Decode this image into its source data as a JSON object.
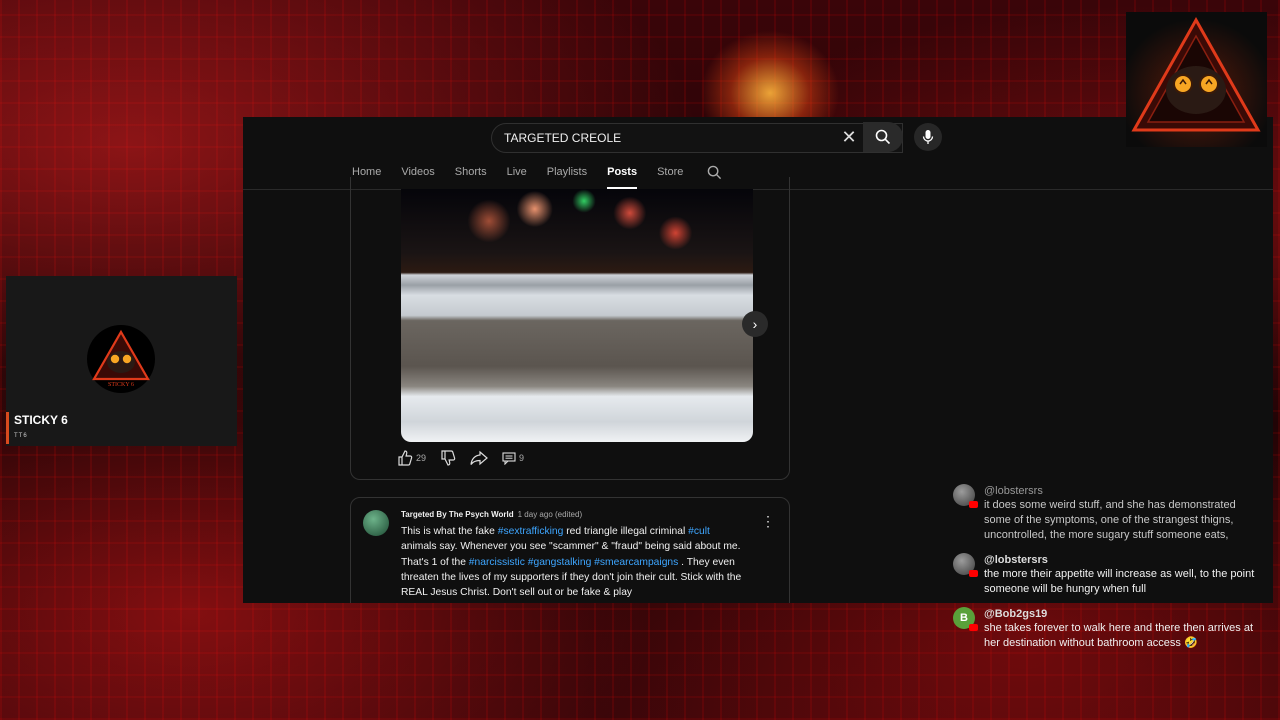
{
  "search": {
    "query": "TARGETED CREOLE"
  },
  "channel_tabs": [
    {
      "label": "Home"
    },
    {
      "label": "Videos"
    },
    {
      "label": "Shorts"
    },
    {
      "label": "Live"
    },
    {
      "label": "Playlists"
    },
    {
      "label": "Posts"
    },
    {
      "label": "Store"
    }
  ],
  "active_tab": "Posts",
  "post1": {
    "likes": "29",
    "comments": "9"
  },
  "post2": {
    "author": "Targeted By The Psych World",
    "time": "1 day ago (edited)",
    "text_parts": [
      "This is what the fake ",
      "#sextrafficking",
      " red triangle illegal criminal ",
      "#cult",
      " animals say. Whenever you see \"scammer\" & \"fraud\" being said about me. That's 1 of the ",
      "#narcissistic",
      " ",
      "#gangstalking",
      " ",
      "#smearcampaigns",
      " . They even threaten the lives of my supporters if they don't join their cult. Stick with the REAL Jesus Christ. Don't sell out or be fake & play"
    ]
  },
  "profile": {
    "name": "STICKY 6",
    "subtitle": "TT6",
    "logo_text": "STICKY 6"
  },
  "chat": [
    {
      "user": "@lobstersrs",
      "text": "it does some weird stuff, and she has demonstrated some of the symptoms, one of the strangest thigns, uncontrolled, the more sugary stuff someone eats,",
      "avatar": "image"
    },
    {
      "user": "@lobstersrs",
      "text": "the more their appetite will increase as well, to the point someone will be hungry when full",
      "avatar": "image"
    },
    {
      "user": "@Bob2gs19",
      "text": "she takes forever to walk here and there then arrives at her destination without bathroom access 🤣",
      "avatar": "B"
    }
  ],
  "colors": {
    "accent_red": "#ff0000",
    "hashtag_blue": "#3ea6ff",
    "profile_bar": "#d84b1e"
  },
  "icons": [
    "search-icon",
    "close-icon",
    "mic-icon",
    "chevron-right-icon",
    "gallery-icon",
    "thumbs-up-icon",
    "thumbs-down-icon",
    "share-icon",
    "comment-icon",
    "more-vert-icon"
  ]
}
